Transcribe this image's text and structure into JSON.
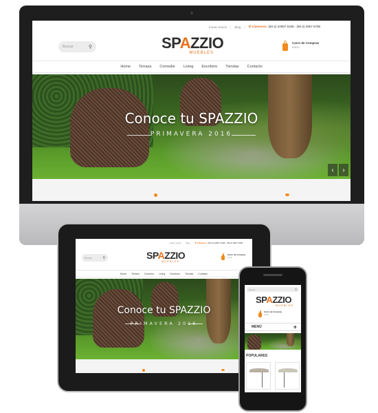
{
  "site": {
    "topbar": {
      "login": "Iniciar sesión",
      "blog": "Blog",
      "call_label": "Llámenos:",
      "phones": "(56-2) 22957 6198 - (56-2) 2957 6798"
    },
    "search_placeholder": "Buscar",
    "logo_main_left": "SP",
    "logo_main_z": "A",
    "logo_main_right": "ZZIO",
    "logo_sub": "MUEBLES",
    "cart_title": "Carro de Compras",
    "cart_status": "vacío",
    "nav": [
      "Home",
      "Terraza",
      "Comedor",
      "Living",
      "Escritorio",
      "Tiendas",
      "Contacto"
    ],
    "hero_title_left": "Conoce tu ",
    "hero_title_brand": "SPAZZIO",
    "hero_subtitle": "PRIMAVERA 2016"
  },
  "mobile": {
    "menu_label": "MENÚ",
    "menu_plus": "+",
    "populares": "POPULARES"
  },
  "colors": {
    "accent": "#f08a1c",
    "brand_text": "#2e2e2e"
  },
  "icons": {
    "search": "search-icon",
    "cart": "shopping-bag-icon",
    "prev": "chevron-left-icon",
    "next": "chevron-right-icon",
    "phone": "phone-icon"
  }
}
